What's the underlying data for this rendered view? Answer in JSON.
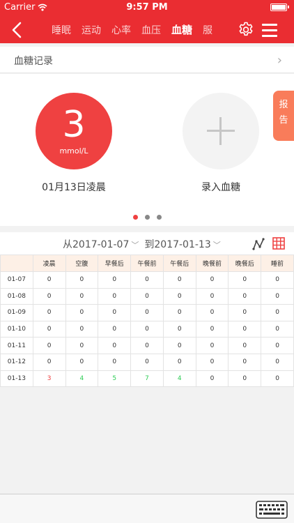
{
  "status_bar": {
    "carrier": "Carrier",
    "time": "9:57 PM"
  },
  "nav": {
    "tabs": [
      {
        "label": "睡眠",
        "active": false
      },
      {
        "label": "运动",
        "active": false
      },
      {
        "label": "心率",
        "active": false
      },
      {
        "label": "血压",
        "active": false
      },
      {
        "label": "血糖",
        "active": true
      },
      {
        "label": "服",
        "active": false
      }
    ]
  },
  "record_header": {
    "title": "血糖记录"
  },
  "card": {
    "reading_value": "3",
    "reading_unit": "mmol/L",
    "reading_label": "01月13日凌晨",
    "add_label": "录入血糖"
  },
  "report_tab": {
    "line1": "报",
    "line2": "告"
  },
  "date_range": {
    "from": "从2017-01-07",
    "to": "到2017-01-13"
  },
  "table": {
    "headers": [
      "",
      "凌晨",
      "空腹",
      "早餐后",
      "午餐前",
      "午餐后",
      "晚餐前",
      "晚餐后",
      "睡前"
    ],
    "rows": [
      {
        "date": "01-07",
        "values": [
          "0",
          "0",
          "0",
          "0",
          "0",
          "0",
          "0",
          "0"
        ]
      },
      {
        "date": "01-08",
        "values": [
          "0",
          "0",
          "0",
          "0",
          "0",
          "0",
          "0",
          "0"
        ]
      },
      {
        "date": "01-09",
        "values": [
          "0",
          "0",
          "0",
          "0",
          "0",
          "0",
          "0",
          "0"
        ]
      },
      {
        "date": "01-10",
        "values": [
          "0",
          "0",
          "0",
          "0",
          "0",
          "0",
          "0",
          "0"
        ]
      },
      {
        "date": "01-11",
        "values": [
          "0",
          "0",
          "0",
          "0",
          "0",
          "0",
          "0",
          "0"
        ]
      },
      {
        "date": "01-12",
        "values": [
          "0",
          "0",
          "0",
          "0",
          "0",
          "0",
          "0",
          "0"
        ]
      },
      {
        "date": "01-13",
        "values": [
          "3",
          "4",
          "5",
          "7",
          "4",
          "0",
          "0",
          "0"
        ]
      }
    ]
  },
  "colors": {
    "brand_red": "#ea2d32",
    "reading_red": "#ef4141",
    "report_orange": "#f97c5a",
    "normal_green": "#2ecc55",
    "table_header_bg": "#fdf0e6"
  }
}
